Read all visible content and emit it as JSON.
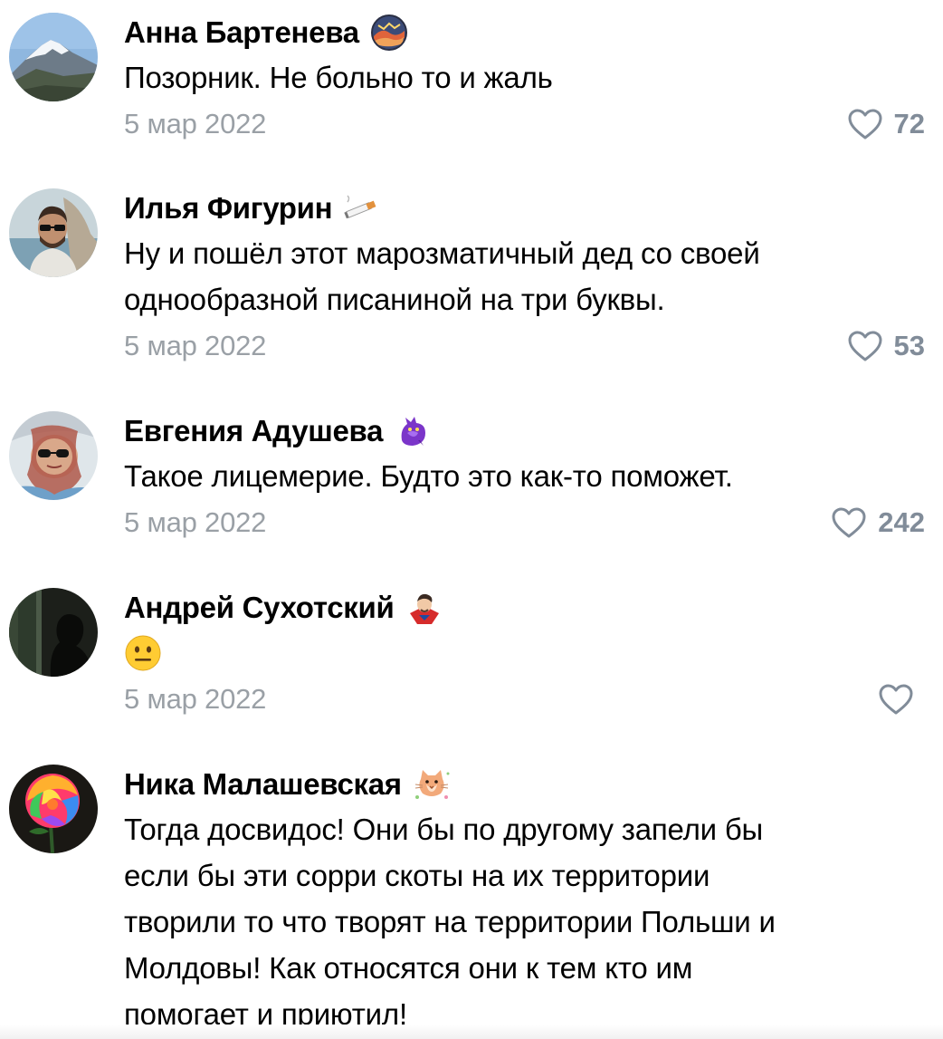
{
  "comments": [
    {
      "author": "Анна Бартенева",
      "badge": "landscape-badge-icon",
      "avatar": "mountain-avatar",
      "text_lines": [
        "Позорник. Не больно то и жаль"
      ],
      "date": "5 мар 2022",
      "likes": "72"
    },
    {
      "author": "Илья Фигурин",
      "badge": "cigarette-badge-icon",
      "avatar": "man-sunglasses-avatar",
      "text_lines": [
        "Ну и пошёл этот марозматичный дед со своей",
        "однообразной писаниной на три буквы."
      ],
      "date": "5 мар 2022",
      "likes": "53"
    },
    {
      "author": "Евгения Адушева",
      "badge": "purple-dragon-badge-icon",
      "avatar": "woman-sunglasses-avatar",
      "text_lines": [
        "Такое лицемерие. Будто это как-то поможет."
      ],
      "date": "5 мар 2022",
      "likes": "242"
    },
    {
      "author": "Андрей Сухотский",
      "badge": "doctor-strange-badge-icon",
      "avatar": "dark-silhouette-avatar",
      "emoji": "neutral-face-emoji",
      "date": "5 мар 2022",
      "likes": ""
    },
    {
      "author": "Ника Малашевская",
      "badge": "cat-badge-icon",
      "avatar": "rainbow-rose-avatar",
      "text_lines": [
        "Тогда досвидос! Они бы по другому запели бы",
        "если бы эти сорри скоты на их территории",
        "творили то что творят на территории Польши и",
        "Молдовы! Как относятся они к тем кто им",
        "помогает и приютил!"
      ],
      "date": "",
      "likes": ""
    }
  ],
  "colors": {
    "date": "#9aa0a6",
    "like_count": "#818c99",
    "heart_outline": "#818c99"
  }
}
